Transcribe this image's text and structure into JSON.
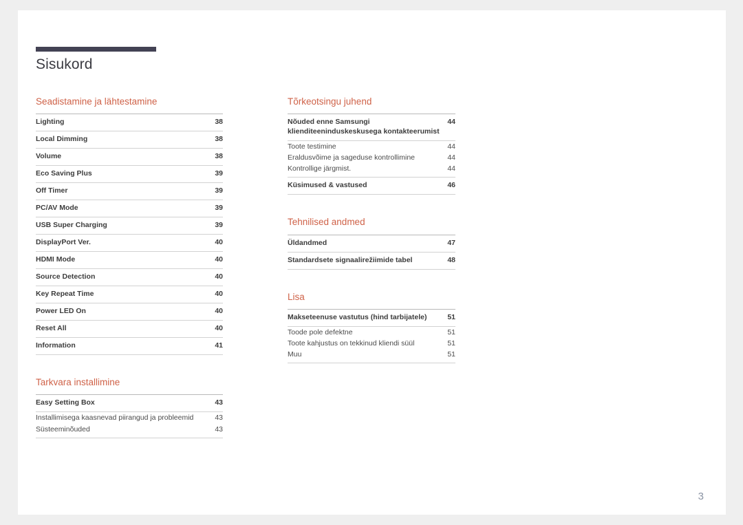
{
  "document": {
    "title": "Sisukord",
    "folio": "3",
    "accent_color": "#cf6248",
    "bar_color": "#434254",
    "folio_color": "#8a93a3"
  },
  "columns": {
    "left": [
      {
        "heading": "Seadistamine ja lähtestamine",
        "entries": [
          {
            "label": "Lighting",
            "page": "38",
            "level": "main"
          },
          {
            "label": "Local Dimming",
            "page": "38",
            "level": "main"
          },
          {
            "label": "Volume",
            "page": "38",
            "level": "main"
          },
          {
            "label": "Eco Saving Plus",
            "page": "39",
            "level": "main"
          },
          {
            "label": "Off Timer",
            "page": "39",
            "level": "main"
          },
          {
            "label": "PC/AV Mode",
            "page": "39",
            "level": "main"
          },
          {
            "label": "USB Super Charging",
            "page": "39",
            "level": "main"
          },
          {
            "label": "DisplayPort Ver.",
            "page": "40",
            "level": "main"
          },
          {
            "label": "HDMI Mode",
            "page": "40",
            "level": "main"
          },
          {
            "label": "Source Detection",
            "page": "40",
            "level": "main"
          },
          {
            "label": "Key Repeat Time",
            "page": "40",
            "level": "main"
          },
          {
            "label": "Power LED On",
            "page": "40",
            "level": "main"
          },
          {
            "label": "Reset All",
            "page": "40",
            "level": "main"
          },
          {
            "label": "Information",
            "page": "41",
            "level": "main"
          }
        ]
      },
      {
        "heading": "Tarkvara installimine",
        "entries": [
          {
            "label": "Easy Setting Box",
            "page": "43",
            "level": "main"
          },
          {
            "label": "Installimisega kaasnevad piirangud ja probleemid",
            "page": "43",
            "level": "sub"
          },
          {
            "label": "Süsteeminõuded",
            "page": "43",
            "level": "sub"
          }
        ]
      }
    ],
    "right": [
      {
        "heading": "Tõrkeotsingu juhend",
        "entries": [
          {
            "label": "Nõuded enne Samsungi klienditeeninduskeskusega kontakteerumist",
            "page": "44",
            "level": "main"
          },
          {
            "label": "Toote testimine",
            "page": "44",
            "level": "sub"
          },
          {
            "label": "Eraldusvõime ja sageduse kontrollimine",
            "page": "44",
            "level": "sub"
          },
          {
            "label": "Kontrollige järgmist.",
            "page": "44",
            "level": "sub"
          },
          {
            "label": "Küsimused & vastused",
            "page": "46",
            "level": "main"
          }
        ]
      },
      {
        "heading": "Tehnilised andmed",
        "entries": [
          {
            "label": "Üldandmed",
            "page": "47",
            "level": "main"
          },
          {
            "label": "Standardsete signaalirežiimide tabel",
            "page": "48",
            "level": "main"
          }
        ]
      },
      {
        "heading": "Lisa",
        "entries": [
          {
            "label": "Makseteenuse vastutus (hind tarbijatele)",
            "page": "51",
            "level": "main"
          },
          {
            "label": "Toode pole defektne",
            "page": "51",
            "level": "sub"
          },
          {
            "label": "Toote kahjustus on tekkinud kliendi süül",
            "page": "51",
            "level": "sub"
          },
          {
            "label": "Muu",
            "page": "51",
            "level": "sub"
          }
        ]
      }
    ]
  }
}
